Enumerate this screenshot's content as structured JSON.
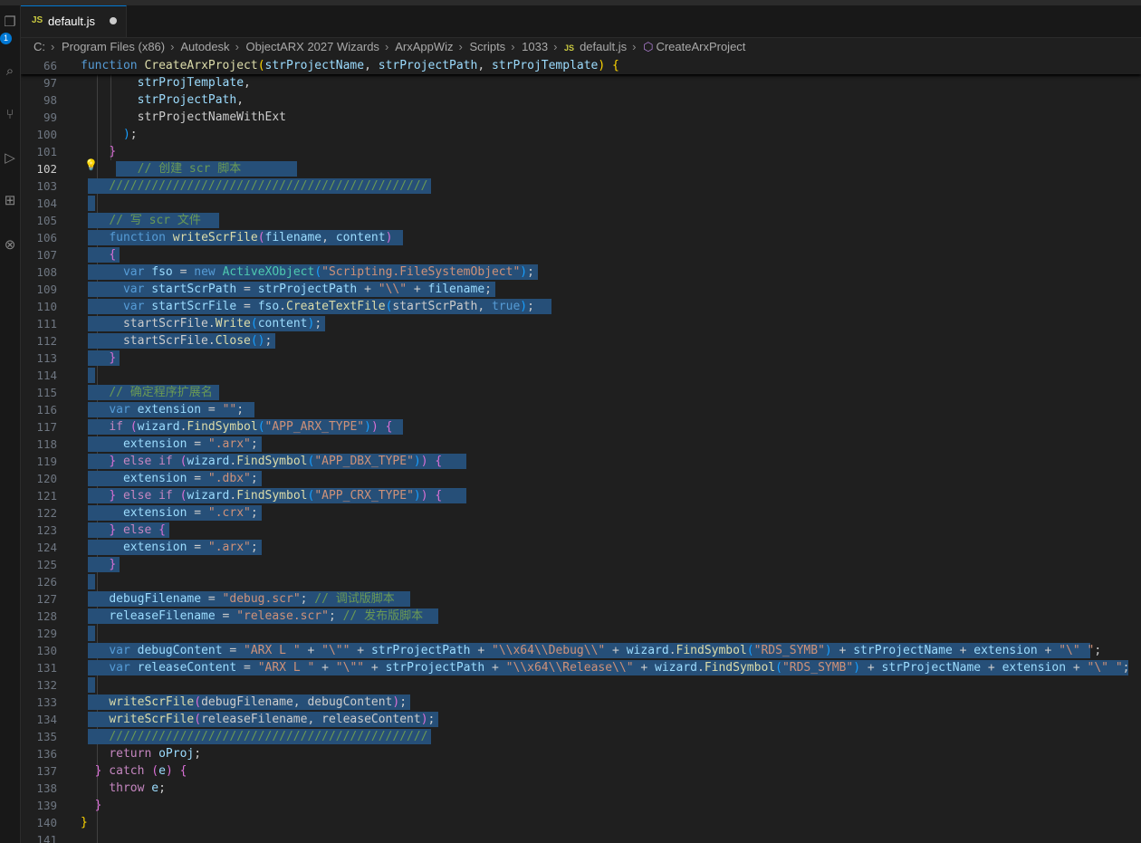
{
  "tab": {
    "label": "default.js",
    "badge": "JS"
  },
  "activity": {
    "badge_count": "1"
  },
  "breadcrumb": {
    "items": [
      "C:",
      "Program Files (x86)",
      "Autodesk",
      "ObjectARX 2027 Wizards",
      "ArxAppWiz",
      "Scripts",
      "1033",
      "default.js",
      "CreateArxProject"
    ]
  },
  "sticky": {
    "line": "66",
    "tokens": [
      {
        "t": "function ",
        "c": "kw"
      },
      {
        "t": "CreateArxProject",
        "c": "fn"
      },
      {
        "t": "(",
        "c": "p1"
      },
      {
        "t": "strProjectName",
        "c": "pm"
      },
      {
        "t": ", ",
        "c": ""
      },
      {
        "t": "strProjectPath",
        "c": "pm"
      },
      {
        "t": ", ",
        "c": ""
      },
      {
        "t": "strProjTemplate",
        "c": "pm"
      },
      {
        "t": ")",
        "c": "p1"
      },
      {
        "t": " {",
        "c": "p1"
      }
    ]
  },
  "lines": [
    {
      "n": "97",
      "sel": 0,
      "tokens": [
        {
          "t": "        "
        },
        {
          "t": "strProjTemplate",
          "c": "pm"
        },
        {
          "t": ","
        }
      ]
    },
    {
      "n": "98",
      "sel": 0,
      "tokens": [
        {
          "t": "        "
        },
        {
          "t": "strProjectPath",
          "c": "pm"
        },
        {
          "t": ","
        }
      ]
    },
    {
      "n": "99",
      "sel": 0,
      "tokens": [
        {
          "t": "        strProjectNameWithExt"
        }
      ]
    },
    {
      "n": "100",
      "sel": 0,
      "tokens": [
        {
          "t": "      "
        },
        {
          "t": ")",
          "c": "p3"
        },
        {
          "t": ";"
        }
      ]
    },
    {
      "n": "101",
      "sel": 0,
      "tokens": [
        {
          "t": "    "
        },
        {
          "t": "}",
          "c": "p2"
        }
      ]
    },
    {
      "n": "102",
      "sel": 1,
      "selFrom": 5,
      "selLen": 26,
      "tokens": [
        {
          "t": "        "
        },
        {
          "t": "// 创建 scr 脚本",
          "c": "cmt"
        }
      ]
    },
    {
      "n": "103",
      "sel": 1,
      "selFrom": 1,
      "selLen": 49,
      "tokens": [
        {
          "t": "    "
        },
        {
          "t": "/////////////////////////////////////////////",
          "c": "cmt"
        }
      ]
    },
    {
      "n": "104",
      "sel": 1,
      "selFrom": 1,
      "selLen": 1,
      "tokens": [
        {
          "t": ""
        }
      ]
    },
    {
      "n": "105",
      "sel": 1,
      "selFrom": 1,
      "selLen": 19,
      "tokens": [
        {
          "t": "    "
        },
        {
          "t": "// 写 scr 文件",
          "c": "cmt"
        }
      ]
    },
    {
      "n": "106",
      "sel": 1,
      "selFrom": 1,
      "selLen": 45,
      "tokens": [
        {
          "t": "    "
        },
        {
          "t": "function ",
          "c": "kw"
        },
        {
          "t": "writeScrFile",
          "c": "fn"
        },
        {
          "t": "(",
          "c": "p2"
        },
        {
          "t": "filename",
          "c": "pm"
        },
        {
          "t": ", "
        },
        {
          "t": "content",
          "c": "pm"
        },
        {
          "t": ")",
          "c": "p2"
        }
      ]
    },
    {
      "n": "107",
      "sel": 1,
      "selFrom": 1,
      "selLen": 5,
      "tokens": [
        {
          "t": "    "
        },
        {
          "t": "{",
          "c": "p2"
        }
      ]
    },
    {
      "n": "108",
      "sel": 1,
      "selFrom": 1,
      "selLen": 64,
      "tokens": [
        {
          "t": "      "
        },
        {
          "t": "var ",
          "c": "kw"
        },
        {
          "t": "fso",
          "c": "id"
        },
        {
          "t": " = "
        },
        {
          "t": "new ",
          "c": "kw"
        },
        {
          "t": "ActiveXObject",
          "c": "cl"
        },
        {
          "t": "(",
          "c": "p3"
        },
        {
          "t": "\"Scripting.FileSystemObject\"",
          "c": "st"
        },
        {
          "t": ")",
          "c": "p3"
        },
        {
          "t": ";"
        }
      ]
    },
    {
      "n": "109",
      "sel": 1,
      "selFrom": 1,
      "selLen": 58,
      "tokens": [
        {
          "t": "      "
        },
        {
          "t": "var ",
          "c": "kw"
        },
        {
          "t": "startScrPath",
          "c": "id"
        },
        {
          "t": " = "
        },
        {
          "t": "strProjectPath",
          "c": "pm"
        },
        {
          "t": " + "
        },
        {
          "t": "\"\\\\\"",
          "c": "st"
        },
        {
          "t": " + "
        },
        {
          "t": "filename",
          "c": "pm"
        },
        {
          "t": ";"
        }
      ]
    },
    {
      "n": "110",
      "sel": 1,
      "selFrom": 1,
      "selLen": 66,
      "tokens": [
        {
          "t": "      "
        },
        {
          "t": "var ",
          "c": "kw"
        },
        {
          "t": "startScrFile",
          "c": "id"
        },
        {
          "t": " = "
        },
        {
          "t": "fso",
          "c": "id"
        },
        {
          "t": "."
        },
        {
          "t": "CreateTextFile",
          "c": "fn"
        },
        {
          "t": "(",
          "c": "p3"
        },
        {
          "t": "startScrPath, "
        },
        {
          "t": "true",
          "c": "kw"
        },
        {
          "t": ")",
          "c": "p3"
        },
        {
          "t": ";"
        }
      ]
    },
    {
      "n": "111",
      "sel": 1,
      "selFrom": 1,
      "selLen": 34,
      "tokens": [
        {
          "t": "      startScrFile."
        },
        {
          "t": "Write",
          "c": "fn"
        },
        {
          "t": "(",
          "c": "p3"
        },
        {
          "t": "content",
          "c": "pm"
        },
        {
          "t": ")",
          "c": "p3"
        },
        {
          "t": ";"
        }
      ]
    },
    {
      "n": "112",
      "sel": 1,
      "selFrom": 1,
      "selLen": 27,
      "tokens": [
        {
          "t": "      startScrFile."
        },
        {
          "t": "Close",
          "c": "fn"
        },
        {
          "t": "()",
          "c": "p3"
        },
        {
          "t": ";"
        }
      ]
    },
    {
      "n": "113",
      "sel": 1,
      "selFrom": 1,
      "selLen": 5,
      "tokens": [
        {
          "t": "    "
        },
        {
          "t": "}",
          "c": "p2"
        }
      ]
    },
    {
      "n": "114",
      "sel": 1,
      "selFrom": 1,
      "selLen": 1,
      "tokens": [
        {
          "t": ""
        }
      ]
    },
    {
      "n": "115",
      "sel": 1,
      "selFrom": 1,
      "selLen": 19,
      "tokens": [
        {
          "t": "    "
        },
        {
          "t": "// 确定程序扩展名",
          "c": "cmt"
        }
      ]
    },
    {
      "n": "116",
      "sel": 1,
      "selFrom": 1,
      "selLen": 24,
      "tokens": [
        {
          "t": "    "
        },
        {
          "t": "var ",
          "c": "kw"
        },
        {
          "t": "extension",
          "c": "id"
        },
        {
          "t": " = "
        },
        {
          "t": "\"\"",
          "c": "st"
        },
        {
          "t": ";"
        }
      ]
    },
    {
      "n": "117",
      "sel": 1,
      "selFrom": 1,
      "selLen": 45,
      "tokens": [
        {
          "t": "    "
        },
        {
          "t": "if ",
          "c": "kw2"
        },
        {
          "t": "(",
          "c": "p2"
        },
        {
          "t": "wizard",
          "c": "id"
        },
        {
          "t": "."
        },
        {
          "t": "FindSymbol",
          "c": "fn"
        },
        {
          "t": "(",
          "c": "p3"
        },
        {
          "t": "\"APP_ARX_TYPE\"",
          "c": "st"
        },
        {
          "t": ")",
          "c": "p3"
        },
        {
          "t": ")",
          "c": "p2"
        },
        {
          "t": " {",
          "c": "p2"
        }
      ]
    },
    {
      "n": "118",
      "sel": 1,
      "selFrom": 1,
      "selLen": 25,
      "tokens": [
        {
          "t": "      "
        },
        {
          "t": "extension",
          "c": "id"
        },
        {
          "t": " = "
        },
        {
          "t": "\".arx\"",
          "c": "st"
        },
        {
          "t": ";"
        }
      ]
    },
    {
      "n": "119",
      "sel": 1,
      "selFrom": 1,
      "selLen": 54,
      "tokens": [
        {
          "t": "    "
        },
        {
          "t": "}",
          "c": "p2"
        },
        {
          "t": " else if ",
          "c": "kw2"
        },
        {
          "t": "(",
          "c": "p2"
        },
        {
          "t": "wizard",
          "c": "id"
        },
        {
          "t": "."
        },
        {
          "t": "FindSymbol",
          "c": "fn"
        },
        {
          "t": "(",
          "c": "p3"
        },
        {
          "t": "\"APP_DBX_TYPE\"",
          "c": "st"
        },
        {
          "t": ")",
          "c": "p3"
        },
        {
          "t": ")",
          "c": "p2"
        },
        {
          "t": " {",
          "c": "p2"
        }
      ]
    },
    {
      "n": "120",
      "sel": 1,
      "selFrom": 1,
      "selLen": 25,
      "tokens": [
        {
          "t": "      "
        },
        {
          "t": "extension",
          "c": "id"
        },
        {
          "t": " = "
        },
        {
          "t": "\".dbx\"",
          "c": "st"
        },
        {
          "t": ";"
        }
      ]
    },
    {
      "n": "121",
      "sel": 1,
      "selFrom": 1,
      "selLen": 54,
      "tokens": [
        {
          "t": "    "
        },
        {
          "t": "}",
          "c": "p2"
        },
        {
          "t": " else if ",
          "c": "kw2"
        },
        {
          "t": "(",
          "c": "p2"
        },
        {
          "t": "wizard",
          "c": "id"
        },
        {
          "t": "."
        },
        {
          "t": "FindSymbol",
          "c": "fn"
        },
        {
          "t": "(",
          "c": "p3"
        },
        {
          "t": "\"APP_CRX_TYPE\"",
          "c": "st"
        },
        {
          "t": ")",
          "c": "p3"
        },
        {
          "t": ")",
          "c": "p2"
        },
        {
          "t": " {",
          "c": "p2"
        }
      ]
    },
    {
      "n": "122",
      "sel": 1,
      "selFrom": 1,
      "selLen": 25,
      "tokens": [
        {
          "t": "      "
        },
        {
          "t": "extension",
          "c": "id"
        },
        {
          "t": " = "
        },
        {
          "t": "\".crx\"",
          "c": "st"
        },
        {
          "t": ";"
        }
      ]
    },
    {
      "n": "123",
      "sel": 1,
      "selFrom": 1,
      "selLen": 12,
      "tokens": [
        {
          "t": "    "
        },
        {
          "t": "}",
          "c": "p2"
        },
        {
          "t": " else ",
          "c": "kw2"
        },
        {
          "t": "{",
          "c": "p2"
        }
      ]
    },
    {
      "n": "124",
      "sel": 1,
      "selFrom": 1,
      "selLen": 25,
      "tokens": [
        {
          "t": "      "
        },
        {
          "t": "extension",
          "c": "id"
        },
        {
          "t": " = "
        },
        {
          "t": "\".arx\"",
          "c": "st"
        },
        {
          "t": ";"
        }
      ]
    },
    {
      "n": "125",
      "sel": 1,
      "selFrom": 1,
      "selLen": 5,
      "tokens": [
        {
          "t": "    "
        },
        {
          "t": "}",
          "c": "p2"
        }
      ]
    },
    {
      "n": "126",
      "sel": 1,
      "selFrom": 1,
      "selLen": 1,
      "tokens": [
        {
          "t": ""
        }
      ]
    },
    {
      "n": "127",
      "sel": 1,
      "selFrom": 1,
      "selLen": 46,
      "tokens": [
        {
          "t": "    "
        },
        {
          "t": "debugFilename",
          "c": "id"
        },
        {
          "t": " = "
        },
        {
          "t": "\"debug.scr\"",
          "c": "st"
        },
        {
          "t": "; "
        },
        {
          "t": "// 调试版脚本",
          "c": "cmt"
        }
      ]
    },
    {
      "n": "128",
      "sel": 1,
      "selFrom": 1,
      "selLen": 50,
      "tokens": [
        {
          "t": "    "
        },
        {
          "t": "releaseFilename",
          "c": "id"
        },
        {
          "t": " = "
        },
        {
          "t": "\"release.scr\"",
          "c": "st"
        },
        {
          "t": "; "
        },
        {
          "t": "// 发布版脚本",
          "c": "cmt"
        }
      ]
    },
    {
      "n": "129",
      "sel": 1,
      "selFrom": 1,
      "selLen": 1,
      "tokens": [
        {
          "t": ""
        }
      ]
    },
    {
      "n": "130",
      "sel": 1,
      "selFrom": 1,
      "selLen": 142,
      "tokens": [
        {
          "t": "    "
        },
        {
          "t": "var ",
          "c": "kw"
        },
        {
          "t": "debugContent",
          "c": "id"
        },
        {
          "t": " = "
        },
        {
          "t": "\"ARX L \"",
          "c": "st"
        },
        {
          "t": " + "
        },
        {
          "t": "\"\\\"\"",
          "c": "st"
        },
        {
          "t": " + "
        },
        {
          "t": "strProjectPath",
          "c": "pm"
        },
        {
          "t": " + "
        },
        {
          "t": "\"\\\\x64\\\\Debug\\\\\"",
          "c": "st"
        },
        {
          "t": " + "
        },
        {
          "t": "wizard",
          "c": "id"
        },
        {
          "t": "."
        },
        {
          "t": "FindSymbol",
          "c": "fn"
        },
        {
          "t": "(",
          "c": "p3"
        },
        {
          "t": "\"RDS_SYMB\"",
          "c": "st"
        },
        {
          "t": ")",
          "c": "p3"
        },
        {
          "t": " + "
        },
        {
          "t": "strProjectName",
          "c": "pm"
        },
        {
          "t": " + "
        },
        {
          "t": "extension",
          "c": "id"
        },
        {
          "t": " + "
        },
        {
          "t": "\"\\\" \"",
          "c": "st"
        },
        {
          "t": ";"
        }
      ]
    },
    {
      "n": "131",
      "sel": 1,
      "selFrom": 1,
      "selLen": 148,
      "tokens": [
        {
          "t": "    "
        },
        {
          "t": "var ",
          "c": "kw"
        },
        {
          "t": "releaseContent",
          "c": "id"
        },
        {
          "t": " = "
        },
        {
          "t": "\"ARX L \"",
          "c": "st"
        },
        {
          "t": " + "
        },
        {
          "t": "\"\\\"\"",
          "c": "st"
        },
        {
          "t": " + "
        },
        {
          "t": "strProjectPath",
          "c": "pm"
        },
        {
          "t": " + "
        },
        {
          "t": "\"\\\\x64\\\\Release\\\\\"",
          "c": "st"
        },
        {
          "t": " + "
        },
        {
          "t": "wizard",
          "c": "id"
        },
        {
          "t": "."
        },
        {
          "t": "FindSymbol",
          "c": "fn"
        },
        {
          "t": "(",
          "c": "p3"
        },
        {
          "t": "\"RDS_SYMB\"",
          "c": "st"
        },
        {
          "t": ")",
          "c": "p3"
        },
        {
          "t": " + "
        },
        {
          "t": "strProjectName",
          "c": "pm"
        },
        {
          "t": " + "
        },
        {
          "t": "extension",
          "c": "id"
        },
        {
          "t": " + "
        },
        {
          "t": "\"\\\" \"",
          "c": "st"
        },
        {
          "t": ";"
        }
      ]
    },
    {
      "n": "132",
      "sel": 1,
      "selFrom": 1,
      "selLen": 1,
      "tokens": [
        {
          "t": ""
        }
      ]
    },
    {
      "n": "133",
      "sel": 1,
      "selFrom": 1,
      "selLen": 46,
      "tokens": [
        {
          "t": "    "
        },
        {
          "t": "writeScrFile",
          "c": "fn"
        },
        {
          "t": "(",
          "c": "p2"
        },
        {
          "t": "debugFilename, debugContent"
        },
        {
          "t": ")",
          "c": "p2"
        },
        {
          "t": ";"
        }
      ]
    },
    {
      "n": "134",
      "sel": 1,
      "selFrom": 1,
      "selLen": 50,
      "tokens": [
        {
          "t": "    "
        },
        {
          "t": "writeScrFile",
          "c": "fn"
        },
        {
          "t": "(",
          "c": "p2"
        },
        {
          "t": "releaseFilename, releaseContent"
        },
        {
          "t": ")",
          "c": "p2"
        },
        {
          "t": ";"
        }
      ]
    },
    {
      "n": "135",
      "sel": 1,
      "selFrom": 1,
      "selLen": 49,
      "tokens": [
        {
          "t": "    "
        },
        {
          "t": "/////////////////////////////////////////////",
          "c": "cmt"
        }
      ]
    },
    {
      "n": "136",
      "sel": 0,
      "tokens": [
        {
          "t": "    "
        },
        {
          "t": "return ",
          "c": "kw2"
        },
        {
          "t": "oProj",
          "c": "id"
        },
        {
          "t": ";"
        }
      ]
    },
    {
      "n": "137",
      "sel": 0,
      "tokens": [
        {
          "t": "  "
        },
        {
          "t": "}",
          "c": "p2"
        },
        {
          "t": " catch ",
          "c": "kw2"
        },
        {
          "t": "(",
          "c": "p2"
        },
        {
          "t": "e",
          "c": "id"
        },
        {
          "t": ")",
          "c": "p2"
        },
        {
          "t": " {",
          "c": "p2"
        }
      ]
    },
    {
      "n": "138",
      "sel": 0,
      "tokens": [
        {
          "t": "    "
        },
        {
          "t": "throw ",
          "c": "kw2"
        },
        {
          "t": "e",
          "c": "id"
        },
        {
          "t": ";"
        }
      ]
    },
    {
      "n": "139",
      "sel": 0,
      "tokens": [
        {
          "t": "  "
        },
        {
          "t": "}",
          "c": "p2"
        }
      ]
    },
    {
      "n": "140",
      "sel": 0,
      "tokens": [
        {
          "t": ""
        },
        {
          "t": "}",
          "c": "p1"
        }
      ]
    },
    {
      "n": "141",
      "sel": 0,
      "tokens": [
        {
          "t": ""
        }
      ]
    }
  ],
  "current_line": "102",
  "colors": {
    "selection": "#264f78",
    "background": "#1f1f1f",
    "accent": "#0078d4"
  }
}
